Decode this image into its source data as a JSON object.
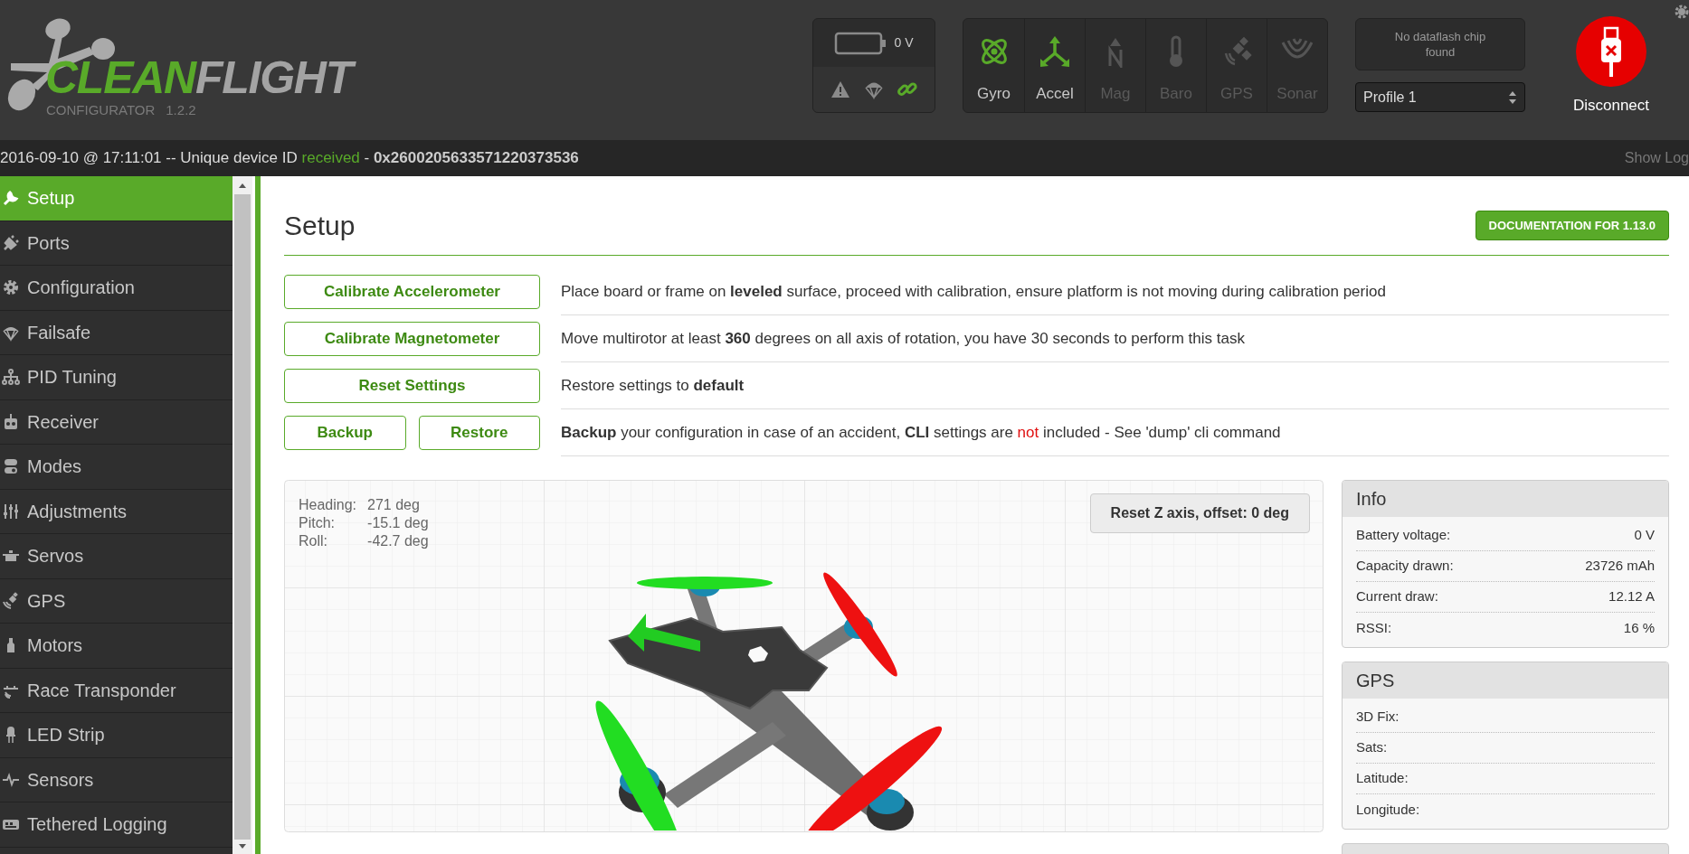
{
  "header": {
    "logo_primary": "CLEAN",
    "logo_secondary": "FLIGHT",
    "subtitle": "CONFIGURATOR",
    "version": "1.2.2",
    "battery": {
      "reading": "0 V"
    },
    "status_icons": [
      {
        "kind": "warning",
        "active": false
      },
      {
        "kind": "failsafe",
        "active": false
      },
      {
        "kind": "link",
        "active": true
      }
    ],
    "sensors": [
      {
        "label": "Gyro",
        "active": true
      },
      {
        "label": "Accel",
        "active": true
      },
      {
        "label": "Mag",
        "active": false
      },
      {
        "label": "Baro",
        "active": false
      },
      {
        "label": "GPS",
        "active": false
      },
      {
        "label": "Sonar",
        "active": false
      }
    ],
    "dataflash": "No dataflash chip found",
    "profile": "Profile 1",
    "disconnect": "Disconnect"
  },
  "log_bar": {
    "message": [
      {
        "text": "2016-09-10 @ 17:11:01 -- Unique device ID ",
        "kind": "plain"
      },
      {
        "text": "received",
        "kind": "success"
      },
      {
        "text": " - ",
        "kind": "plain"
      },
      {
        "text": "0x2600205633571220373536",
        "kind": "bold"
      }
    ],
    "show_log": "Show Log"
  },
  "sidebar": {
    "items": [
      {
        "label": "Setup",
        "selected": true
      },
      {
        "label": "Ports",
        "selected": false
      },
      {
        "label": "Configuration",
        "selected": false
      },
      {
        "label": "Failsafe",
        "selected": false
      },
      {
        "label": "PID Tuning",
        "selected": false
      },
      {
        "label": "Receiver",
        "selected": false
      },
      {
        "label": "Modes",
        "selected": false
      },
      {
        "label": "Adjustments",
        "selected": false
      },
      {
        "label": "Servos",
        "selected": false
      },
      {
        "label": "GPS",
        "selected": false
      },
      {
        "label": "Motors",
        "selected": false
      },
      {
        "label": "Race Transponder",
        "selected": false
      },
      {
        "label": "LED Strip",
        "selected": false
      },
      {
        "label": "Sensors",
        "selected": false
      },
      {
        "label": "Tethered Logging",
        "selected": false
      }
    ]
  },
  "page": {
    "title": "Setup",
    "documentation": "DOCUMENTATION FOR 1.13.0",
    "actions": [
      {
        "buttons": [
          "Calibrate Accelerometer"
        ],
        "description": [
          {
            "text": "Place board or frame on ",
            "kind": "plain"
          },
          {
            "text": "leveled",
            "kind": "bold"
          },
          {
            "text": " surface, proceed with calibration, ensure platform is not moving during calibration period",
            "kind": "plain"
          }
        ]
      },
      {
        "buttons": [
          "Calibrate Magnetometer"
        ],
        "description": [
          {
            "text": "Move multirotor at least ",
            "kind": "plain"
          },
          {
            "text": "360",
            "kind": "bold"
          },
          {
            "text": " degrees on all axis of rotation, you have 30 seconds to perform this task",
            "kind": "plain"
          }
        ]
      },
      {
        "buttons": [
          "Reset Settings"
        ],
        "description": [
          {
            "text": "Restore settings to ",
            "kind": "plain"
          },
          {
            "text": "default",
            "kind": "bold"
          }
        ]
      },
      {
        "buttons": [
          "Backup",
          "Restore"
        ],
        "description": [
          {
            "text": "Backup",
            "kind": "bold"
          },
          {
            "text": " your configuration in case of an accident, ",
            "kind": "plain"
          },
          {
            "text": "CLI",
            "kind": "bold"
          },
          {
            "text": " settings are ",
            "kind": "plain"
          },
          {
            "text": "not",
            "kind": "warning"
          },
          {
            "text": " included - See 'dump' cli command",
            "kind": "plain"
          }
        ]
      }
    ],
    "attitude": [
      {
        "label": "Heading:",
        "value": "271 deg"
      },
      {
        "label": "Pitch:",
        "value": "-15.1 deg"
      },
      {
        "label": "Roll:",
        "value": "-42.7 deg"
      }
    ],
    "reset_z": "Reset Z axis, offset: 0 deg",
    "panels": [
      {
        "title": "Info",
        "rows": [
          {
            "label": "Battery voltage:",
            "value": "0 V"
          },
          {
            "label": "Capacity drawn:",
            "value": "23726 mAh"
          },
          {
            "label": "Current draw:",
            "value": "12.12 A"
          },
          {
            "label": "RSSI:",
            "value": "16 %"
          }
        ]
      },
      {
        "title": "GPS",
        "rows": [
          {
            "label": "3D Fix:"
          },
          {
            "label": "Sats:"
          },
          {
            "label": "Latitude:"
          },
          {
            "label": "Longitude:"
          }
        ]
      }
    ]
  }
}
